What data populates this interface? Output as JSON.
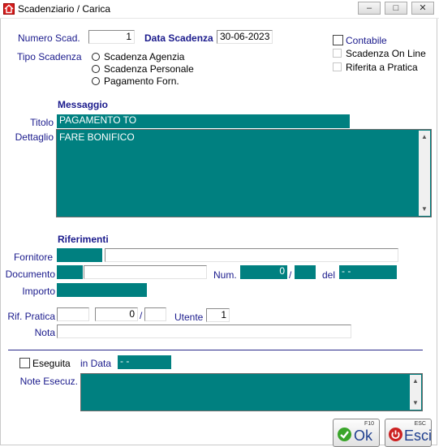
{
  "window": {
    "title": "Scadenziario / Carica",
    "minimize_glyph": "–",
    "maximize_glyph": "□",
    "close_glyph": "✕"
  },
  "header": {
    "numero_scad_label": "Numero Scad.",
    "numero_scad_value": "1",
    "data_scadenza_label": "Data Scadenza",
    "data_scadenza_value": "30-06-2023",
    "tipo_scadenza_label": "Tipo Scadenza",
    "tipo_options": [
      "Scadenza Agenzia",
      "Scadenza Personale",
      "Pagamento Forn."
    ],
    "contabile_label": "Contabile",
    "scadenza_online_label": "Scadenza On Line",
    "riferita_pratica_label": "Riferita a Pratica"
  },
  "messaggio": {
    "section_label": "Messaggio",
    "titolo_label": "Titolo",
    "titolo_value": "PAGAMENTO TO",
    "dettaglio_label": "Dettaglio",
    "dettaglio_value": "FARE BONIFICO"
  },
  "riferimenti": {
    "section_label": "Riferimenti",
    "fornitore_label": "Fornitore",
    "fornitore_code": "",
    "fornitore_name": "",
    "documento_label": "Documento",
    "documento_code": "",
    "documento_desc": "",
    "num_label": "Num.",
    "num_value": "0",
    "num_suffix": "",
    "slash": "/",
    "del_label": "del",
    "del_value": "- -",
    "importo_label": "Importo",
    "importo_value": "",
    "rif_pratica_label": "Rif. Pratica",
    "rif_pratica_a": "",
    "rif_pratica_b": "0",
    "rif_pratica_c": "",
    "utente_label": "Utente",
    "utente_value": "1",
    "nota_label": "Nota",
    "nota_value": ""
  },
  "esecuzione": {
    "eseguita_label": "Eseguita",
    "in_data_label": "in Data",
    "in_data_value": "- -",
    "note_label": "Note Esecuz.",
    "note_value": ""
  },
  "buttons": {
    "ok_key": "F10",
    "ok_label": "Ok",
    "esci_key": "ESC",
    "esci_label": "Esci"
  },
  "colors": {
    "field_teal": "#008080",
    "label_blue": "#1a1a8c",
    "ok_icon_green": "#3aa52a",
    "esci_icon_red": "#cc2222"
  },
  "icons": {
    "app": "home-icon",
    "ok": "check-icon",
    "esci": "power-icon"
  }
}
